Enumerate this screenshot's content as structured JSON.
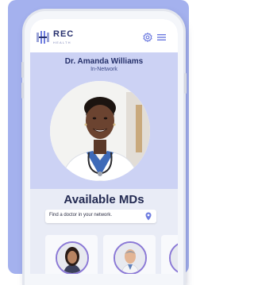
{
  "brand": {
    "name": "REC",
    "tagline": "HEALTH",
    "accent": "#6f7de0"
  },
  "doctor": {
    "name": "Dr. Amanda Williams",
    "network": "In-Network"
  },
  "section": {
    "title": "Available MDs"
  },
  "search": {
    "placeholder": "Find a doctor in your network."
  },
  "icons": {
    "settings": "gear-icon",
    "menu": "hamburger-menu-icon",
    "location": "location-pin-icon"
  },
  "colors": {
    "backdrop": "#a4b1ee",
    "header_band": "#ccd2f4",
    "title_text": "#25306a",
    "avatar_ring": "#8b79d6"
  },
  "doctor_cards": [
    {
      "id": "card-1"
    },
    {
      "id": "card-2"
    },
    {
      "id": "card-3"
    }
  ]
}
